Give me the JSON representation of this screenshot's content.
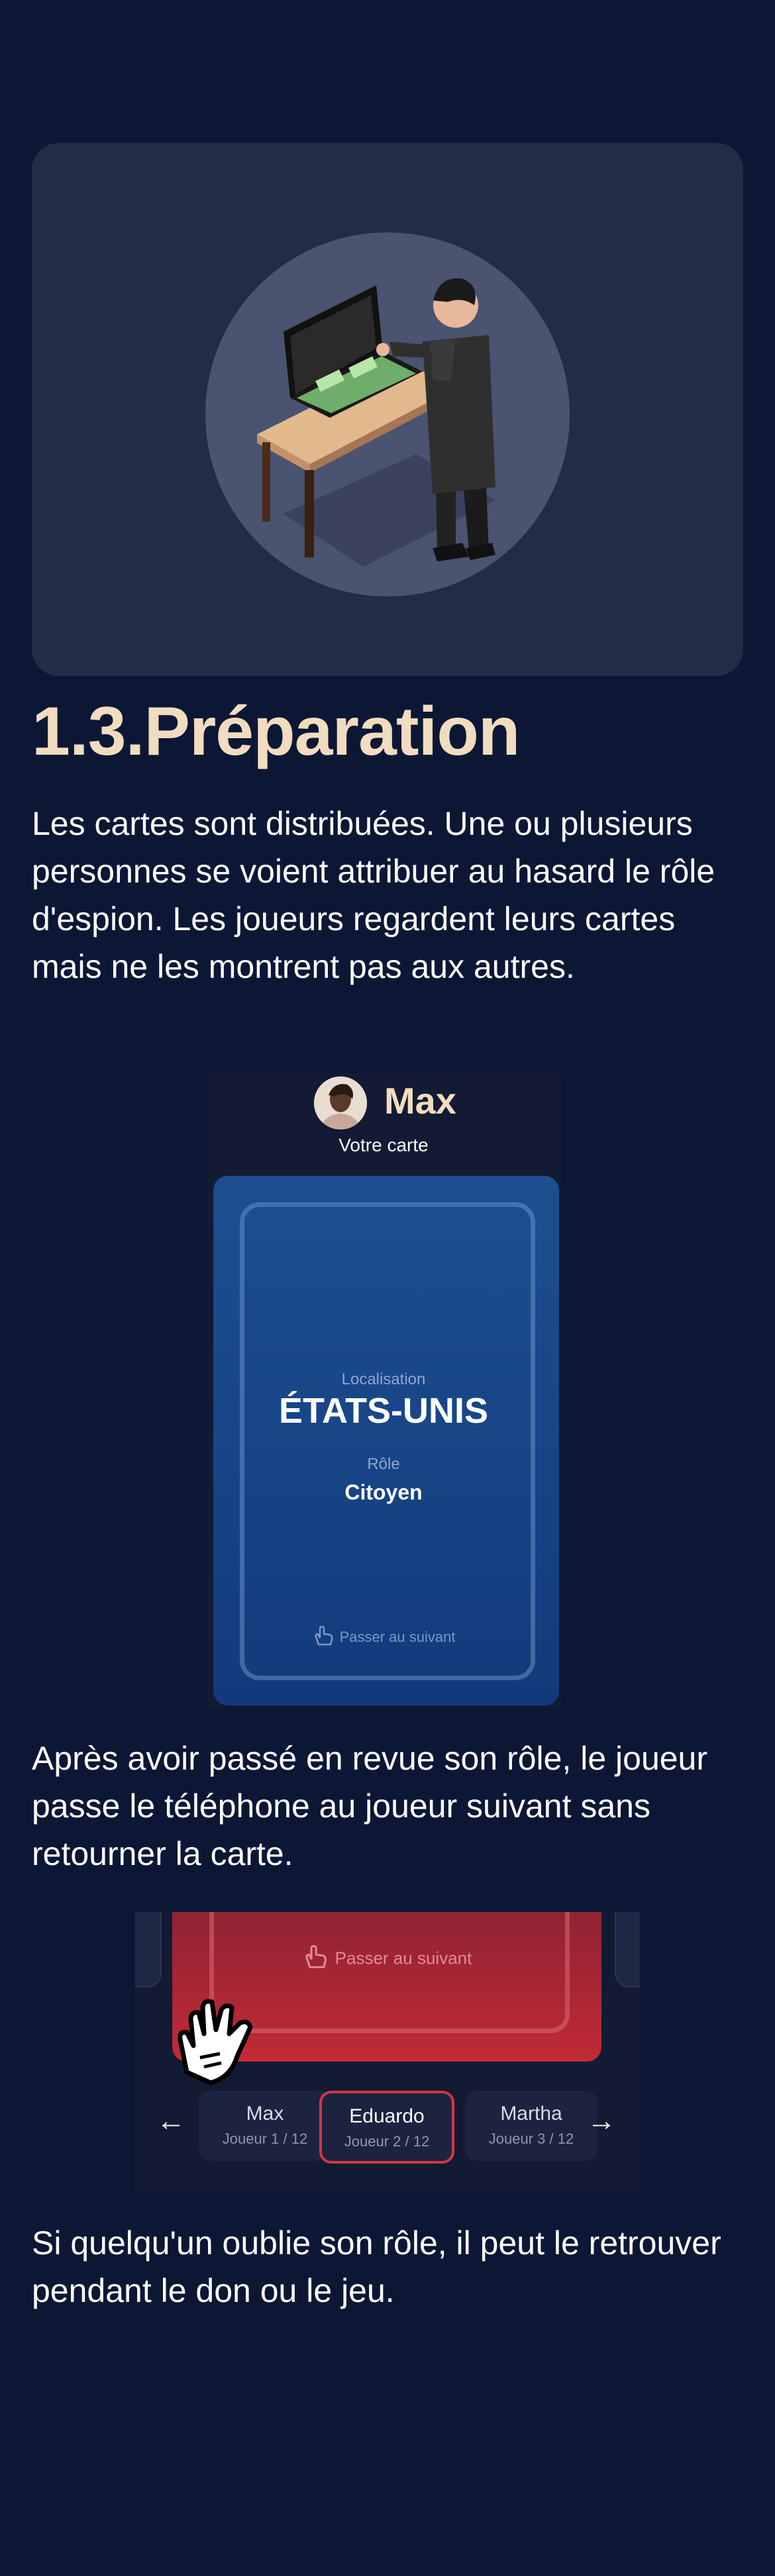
{
  "section": {
    "title": "1.3.Préparation",
    "para1": "Les cartes sont distribuées. Une ou plusieurs personnes se voient attribuer au hasard le rôle d'espion. Les joueurs regardent leurs cartes mais ne les montrent pas aux autres.",
    "para2": "Après avoir passé en revue son rôle, le joueur passe le téléphone au joueur suivant sans retourner la carte.",
    "para3": "Si quelqu'un oublie son rôle, il peut le retrouver pendant le don ou le jeu."
  },
  "screen1": {
    "player_name": "Max",
    "your_card_label": "Votre carte",
    "location_label": "Localisation",
    "location_value": "ÉTATS-UNIS",
    "role_label": "Rôle",
    "role_value": "Citoyen",
    "pass_label": "Passer au suivant"
  },
  "screen2": {
    "pass_label": "Passer au suivant",
    "players": [
      {
        "name": "Max",
        "sub": "Joueur 1 / 12"
      },
      {
        "name": "Eduardo",
        "sub": "Joueur 2 / 12"
      },
      {
        "name": "Martha",
        "sub": "Joueur 3 / 12"
      }
    ],
    "active_player_index": 1
  },
  "icons": {
    "illustration": "spy-with-briefcase-illustration",
    "avatar": "player-avatar",
    "hand": "tap-hand-icon",
    "prev": "arrow-left-icon",
    "next": "arrow-right-icon"
  },
  "colors": {
    "background": "#0c1735",
    "title": "#f2dcc0",
    "card_blue": "#1a4a8a",
    "card_red": "#c12a36",
    "active_border": "#d23744"
  }
}
